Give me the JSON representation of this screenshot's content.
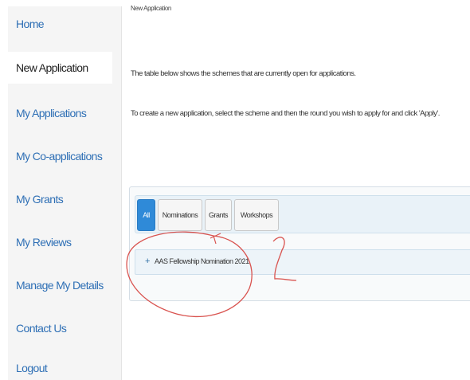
{
  "sidebar": {
    "items": [
      {
        "label": "Home",
        "active": false
      },
      {
        "label": "New Application",
        "active": true
      },
      {
        "label": "My Applications",
        "active": false
      },
      {
        "label": "My Co-applications",
        "active": false
      },
      {
        "label": "My Grants",
        "active": false
      },
      {
        "label": "My Reviews",
        "active": false
      },
      {
        "label": "Manage My Details",
        "active": false
      },
      {
        "label": "Contact Us",
        "active": false
      },
      {
        "label": "Logout",
        "active": false
      }
    ]
  },
  "main": {
    "page_title": "New Application",
    "intro_1": "The table below shows the schemes that are currently open for applications.",
    "intro_2": "To create a new application, select the scheme and then the round you wish to apply for and click 'Apply'.",
    "tabs": [
      {
        "label": "All",
        "active": true
      },
      {
        "label": "Nominations",
        "active": false
      },
      {
        "label": "Grants",
        "active": false
      },
      {
        "label": "Workshops",
        "active": false
      }
    ],
    "schemes": [
      {
        "expand_symbol": "+",
        "label": "AAS Fellowship Nomination 2021"
      }
    ]
  },
  "annotation": {
    "number": "2",
    "color": "#d9534f"
  },
  "colors": {
    "link": "#2e6fb5",
    "active_tab": "#2f8ad8",
    "sidebar_bg": "#f5f5f5"
  }
}
